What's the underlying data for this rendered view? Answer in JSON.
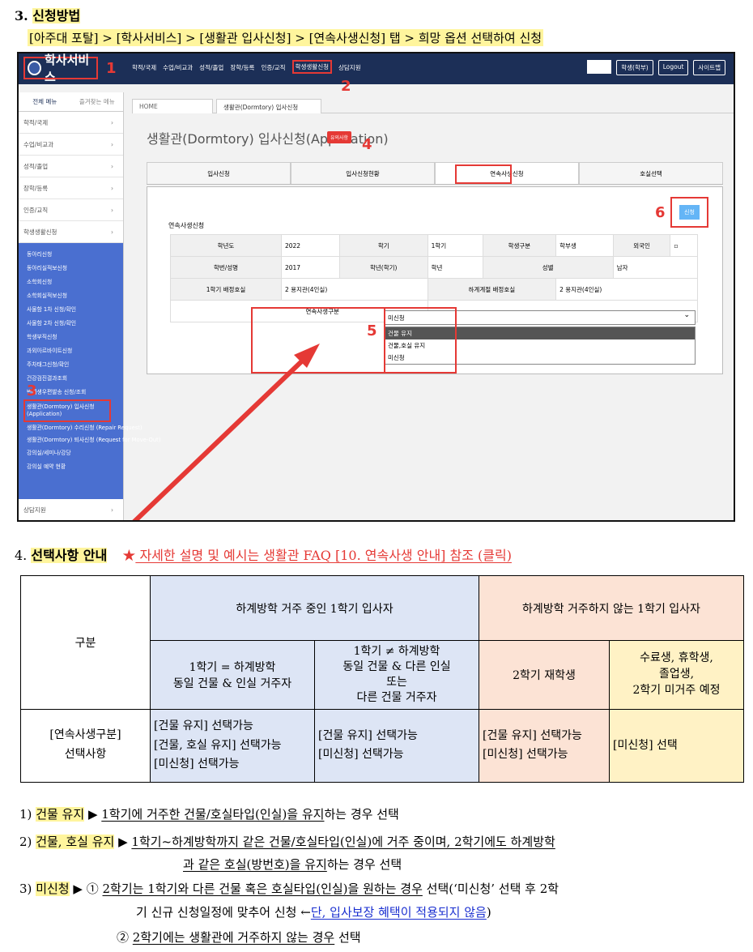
{
  "section3": {
    "number": "3.",
    "title": "신청방법",
    "path": "[아주대 포탈] > [학사서비스] > [생활관 입사신청] > [연속사생신청] 탭 > 희망 옵션 선택하여 신청"
  },
  "screenshot": {
    "logo_text": "학사서비스",
    "nav": [
      "학적/국제",
      "수업/비교과",
      "성적/졸업",
      "장학/등록",
      "인증/교직",
      "학생생활신청",
      "상담지원"
    ],
    "nav_selected": "학생생활신청",
    "top_right": {
      "role": "학생(학부)",
      "logout": "Logout",
      "sitemap": "사이트맵"
    },
    "sidebar_tabs": [
      "전체 메뉴",
      "즐겨찾는 메뉴"
    ],
    "sidebar_items": [
      "학적/국제",
      "수업/비교과",
      "성적/졸업",
      "장학/등록",
      "인증/교직",
      "학생생활신청"
    ],
    "sidebar_sub": [
      "동아리신청",
      "동아리실적보신청",
      "소학회신청",
      "소학회실적보신청",
      "사물함 1차 신청/확인",
      "사물함 2차 신청/확인",
      "학생부직신청",
      "과외아르바이트신청",
      "주차태그신청/확인",
      "건강검진결과조회",
      "변태생우편발송 신청/조회"
    ],
    "sidebar_selected": "생활관(Dormtory) 입사신청 (Application)",
    "sidebar_after": [
      "생활관(Dormtory) 수리신청 (Repair Request)",
      "생활관(Dormtory) 퇴사신청 (Request for Move-Out)",
      "강의실/세미나/강당",
      "강의실 예약 현황"
    ],
    "sidebar_bottom": "상담지원",
    "tab_home": "HOME",
    "tab_page": "생활관(Dormtory) 입사신청",
    "page_title": "생활관(Dormtory) 입사신청(Application)",
    "badge": "유의사항",
    "main_tabs": [
      "입사신청",
      "입사신청현황",
      "연속사생신청",
      "호실선택"
    ],
    "active_tab": "연속사생신청",
    "sub_title": "연속사생신청",
    "apply_button": "신청",
    "form": {
      "row1": [
        "학년도",
        "2022",
        "학기",
        "1학기",
        "학생구분",
        "학부생",
        "외국인",
        ""
      ],
      "row2": [
        "학번/성명",
        "2017",
        "학년(학기)",
        "학년",
        "성별",
        "남자"
      ],
      "row3": [
        "1학기 배정호실",
        "2   용지관(4인실)",
        "하계계절 배정호실",
        "2   용지관(4인실)"
      ],
      "select_label": "연속사생구분",
      "select_value": "미신청",
      "options": [
        "건물 유지",
        "건물,호실 유지",
        "미신청"
      ]
    },
    "markers": [
      "1",
      "2",
      "3",
      "4",
      "5",
      "6"
    ]
  },
  "section4": {
    "number": "4.",
    "title": "선택사항 안내",
    "star": "★",
    "link": " 자세한 설명 및 예시는 생활관 FAQ [10. 연속사생 안내] 참조 (클릭)"
  },
  "table": {
    "corner": "구분",
    "group1": "하계방학 거주 중인 1학기 입사자",
    "group2": "하계방학 거주하지 않는 1학기 입사자",
    "col1": [
      "1학기 = 하계방학",
      "동일 건물 & 인실 거주자"
    ],
    "col2": [
      "1학기 ≠ 하계방학",
      "동일 건물 & 다른 인실",
      "또는",
      "다른 건물 거주자"
    ],
    "col3": "2학기 재학생",
    "col4": [
      "수료생, 휴학생,",
      "졸업생,",
      "2학기 미거주 예정"
    ],
    "row_label": [
      "[연속사생구분]",
      "선택사항"
    ],
    "cell1": [
      "[건물 유지] 선택가능",
      "[건물, 호실 유지] 선택가능",
      "[미신청] 선택가능"
    ],
    "cell2": [
      "[건물 유지] 선택가능",
      "[미신청] 선택가능"
    ],
    "cell3": [
      "[건물 유지] 선택가능",
      "[미신청] 선택가능"
    ],
    "cell4": "[미신청] 선택"
  },
  "notes": {
    "n1_prefix": "1)",
    "n1_key": "건물 유지",
    "n1_arrow": "▶",
    "n1_u": "1학기에 거주한 건물/호실타입(인실)을 유지",
    "n1_rest": "하는 경우 선택",
    "n2_prefix": "2)",
    "n2_key": "건물, 호실 유지",
    "n2_arrow": "▶",
    "n2_u1": "1학기~하계방학까지 같은 건물/호실타입(인실)에 거주 중이며, 2학기에도 하계방학",
    "n2_u2": "과 같은 호실(방번호)을 유지",
    "n2_rest": "하는 경우 선택",
    "n3_prefix": "3)",
    "n3_key": "미신청",
    "n3_arrow": "▶",
    "n3_c1": "①",
    "n3_u1": "2학기는 1학기와 다른 건물 혹은 호실타입(인실)을 원하는 경우",
    "n3_rest1": " 선택(‘미신청’ 선택 후 2학",
    "n3_line2": "기 신규 신청일정에 맞추어 신청 ←",
    "n3_blue": "단, 입사보장 혜택이 적용되지 않음",
    "n3_close": ")",
    "n3_c2": "②",
    "n3_u2": "2학기에는 생활관에 거주하지 않는 경우",
    "n3_rest2": " 선택"
  }
}
